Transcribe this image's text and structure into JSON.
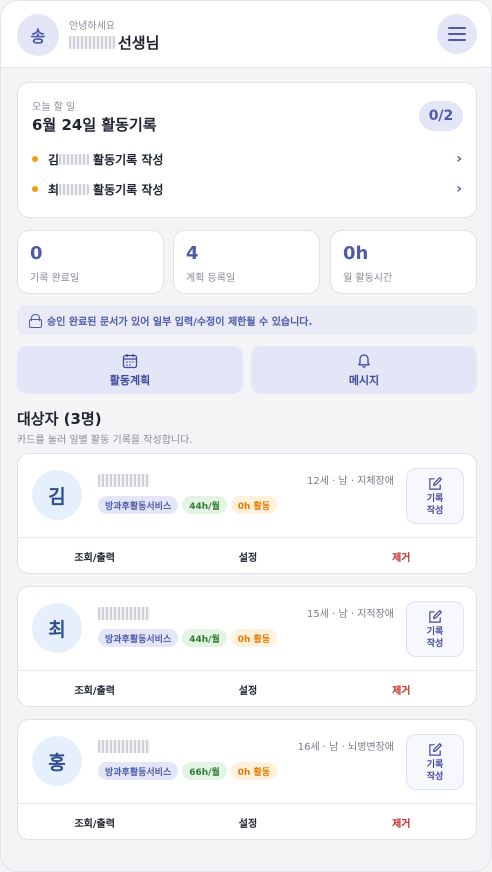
{
  "header": {
    "avatar_initial": "송",
    "greeting": "안녕하세요",
    "teacher_suffix": "선생님"
  },
  "today": {
    "label": "오늘 할 일",
    "title": "6월 24일 활동기록",
    "progress": "0/2",
    "tasks": [
      {
        "prefix": "김",
        "label": "활동기록 작성"
      },
      {
        "prefix": "최",
        "label": "활동기록 작성"
      }
    ]
  },
  "stats": [
    {
      "value": "0",
      "label": "기록 완료일"
    },
    {
      "value": "4",
      "label": "계획 등록일"
    },
    {
      "value": "0h",
      "label": "월 활동시간"
    }
  ],
  "notice": "승인 완료된 문서가 있어 일부 입력/수정이 제한될 수 있습니다.",
  "quick": {
    "plan_label": "활동계획",
    "message_label": "메시지"
  },
  "section": {
    "title": "대상자 (3명)",
    "subtitle": "카드를 눌러 일별 활동 기록을 작성합니다."
  },
  "clients": [
    {
      "initial": "김",
      "meta": "12세 · 남 · 지체장애",
      "service": "방과후활동서비스",
      "hours": "44h/월",
      "activity": "0h 활동"
    },
    {
      "initial": "최",
      "meta": "15세 · 남 · 지적장애",
      "service": "방과후활동서비스",
      "hours": "44h/월",
      "activity": "0h 활동"
    },
    {
      "initial": "홍",
      "meta": "16세 · 남 · 뇌병변장애",
      "service": "방과후활동서비스",
      "hours": "66h/월",
      "activity": "0h 활동"
    }
  ],
  "client_actions": {
    "view": "조회/출력",
    "settings": "설정",
    "remove": "제거",
    "record_line1": "기록",
    "record_line2": "작성"
  },
  "colors": {
    "accent": "#4e5aa8",
    "warning": "#f39c12",
    "danger": "#c62828",
    "success": "#2e7d32"
  }
}
